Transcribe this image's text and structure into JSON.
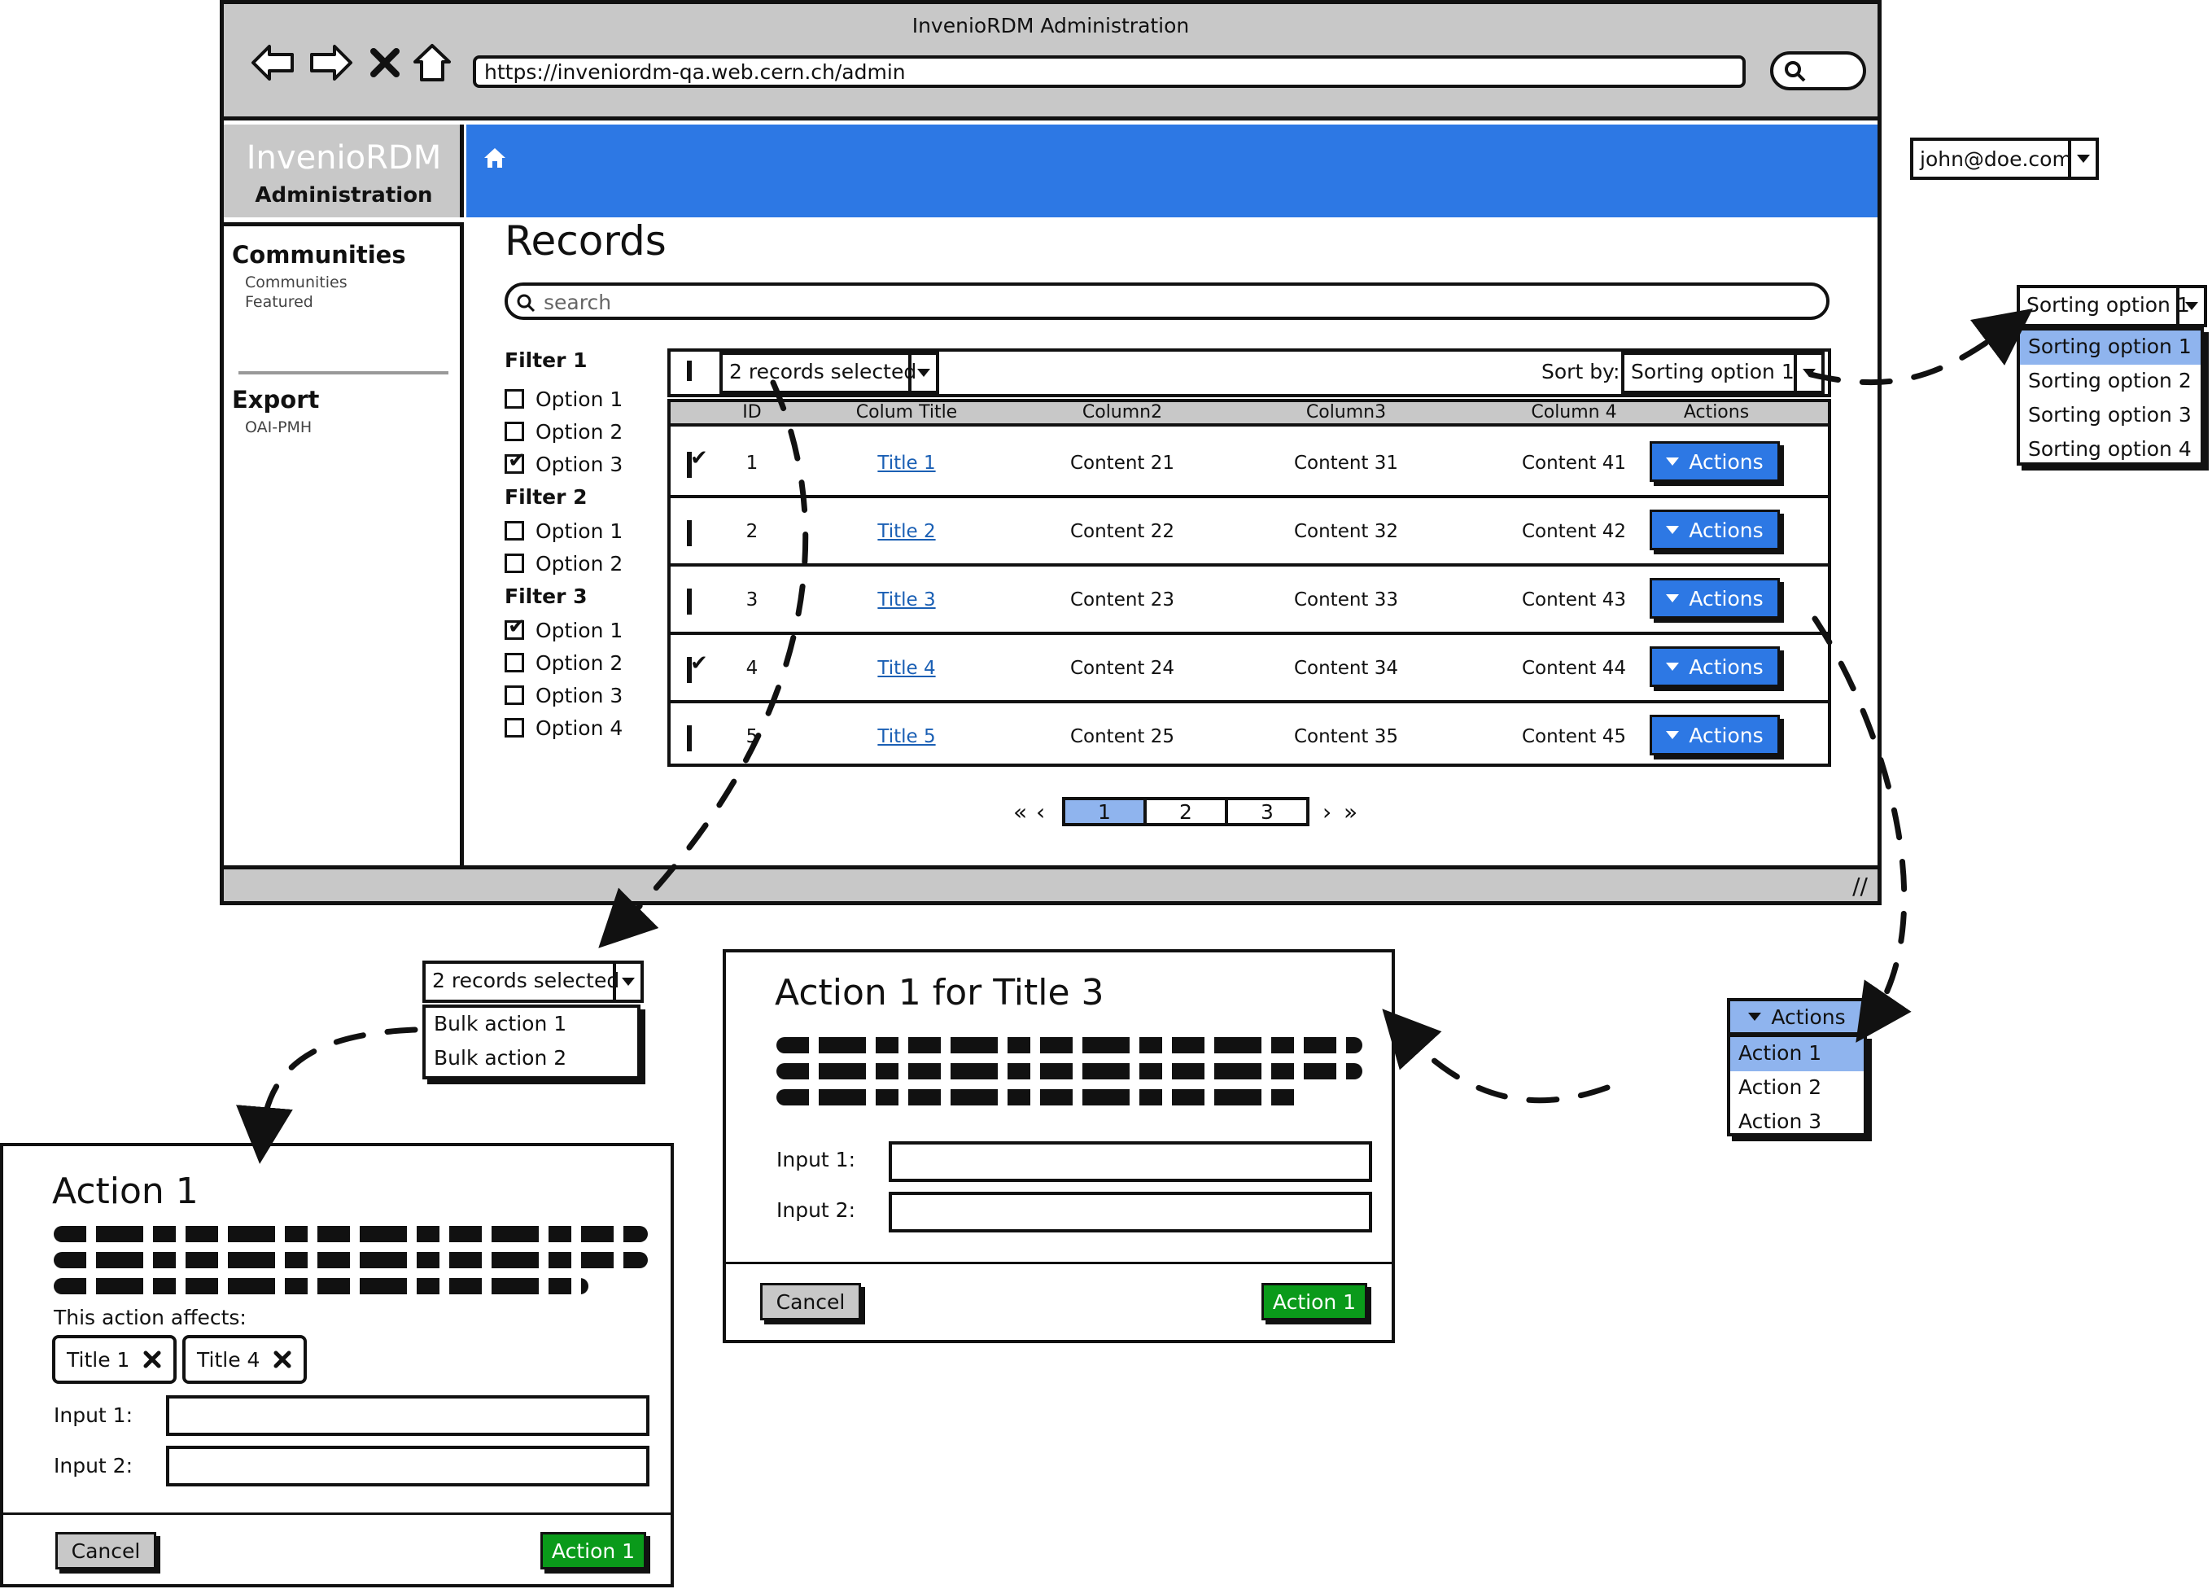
{
  "browser": {
    "window_title": "InvenioRDM Administration",
    "url": "https://inveniordm-qa.web.cern.ch/admin",
    "nav": {
      "back": "back-icon",
      "forward": "forward-icon",
      "stop": "close-icon",
      "home": "home-icon"
    }
  },
  "brand": {
    "title": "InvenioRDM",
    "subtitle": "Administration"
  },
  "topbar": {
    "user": "john@doe.com",
    "accent": "#2d78e4"
  },
  "sidebar": {
    "sections": [
      {
        "heading": "Communities",
        "items": [
          "Communities",
          "Featured"
        ]
      },
      {
        "heading": "Export",
        "items": [
          "OAI-PMH"
        ]
      }
    ]
  },
  "page": {
    "title": "Records",
    "search_placeholder": "search"
  },
  "filters": [
    {
      "heading": "Filter 1",
      "options": [
        {
          "label": "Option 1",
          "checked": false
        },
        {
          "label": "Option 2",
          "checked": false
        },
        {
          "label": "Option 3",
          "checked": true
        }
      ]
    },
    {
      "heading": "Filter 2",
      "options": [
        {
          "label": "Option 1",
          "checked": false
        },
        {
          "label": "Option 2",
          "checked": false
        }
      ]
    },
    {
      "heading": "Filter 3",
      "options": [
        {
          "label": "Option 1",
          "checked": true
        },
        {
          "label": "Option 2",
          "checked": false
        },
        {
          "label": "Option 3",
          "checked": false
        },
        {
          "label": "Option 4",
          "checked": false
        }
      ]
    }
  ],
  "toolbar": {
    "selection": "2 records selected",
    "sort_label": "Sort by:",
    "sort_value": "Sorting option 1"
  },
  "table": {
    "columns": [
      "ID",
      "Colum Title",
      "Column2",
      "Column3",
      "Column 4",
      "Actions"
    ],
    "rows": [
      {
        "checked": true,
        "id": "1",
        "title": "Title 1",
        "c2": "Content 21",
        "c3": "Content 31",
        "c4": "Content 41",
        "action": "Actions"
      },
      {
        "checked": false,
        "id": "2",
        "title": "Title 2",
        "c2": "Content 22",
        "c3": "Content 32",
        "c4": "Content 42",
        "action": "Actions"
      },
      {
        "checked": false,
        "id": "3",
        "title": "Title 3",
        "c2": "Content 23",
        "c3": "Content 33",
        "c4": "Content 43",
        "action": "Actions"
      },
      {
        "checked": true,
        "id": "4",
        "title": "Title 4",
        "c2": "Content 24",
        "c3": "Content 34",
        "c4": "Content 44",
        "action": "Actions"
      },
      {
        "checked": false,
        "id": "5",
        "title": "Title 5",
        "c2": "Content 25",
        "c3": "Content 35",
        "c4": "Content 45",
        "action": "Actions"
      }
    ]
  },
  "pagination": {
    "first": "«",
    "prev": "‹",
    "pages": [
      "1",
      "2",
      "3"
    ],
    "active": "1",
    "next": "›",
    "last": "»"
  },
  "sort_menu": {
    "value": "Sorting option 1",
    "options": [
      "Sorting option 1",
      "Sorting option 2",
      "Sorting option 3",
      "Sorting option 4"
    ],
    "selected": 0
  },
  "bulk_menu": {
    "value": "2 records selected",
    "options": [
      "Bulk action 1",
      "Bulk action 2"
    ]
  },
  "actions_menu": {
    "label": "Actions",
    "options": [
      "Action 1",
      "Action 2",
      "Action 3"
    ],
    "selected": 0
  },
  "dialog_bulk": {
    "title": "Action 1",
    "affects_label": "This action affects:",
    "chips": [
      "Title 1",
      "Title 4"
    ],
    "input1_label": "Input 1:",
    "input2_label": "Input 2:",
    "cancel": "Cancel",
    "confirm": "Action 1"
  },
  "dialog_single": {
    "title": "Action 1 for Title 3",
    "input1_label": "Input 1:",
    "input2_label": "Input 2:",
    "cancel": "Cancel",
    "confirm": "Action 1"
  },
  "colors": {
    "primary": "#2d78e4",
    "selected": "#8fb4ee",
    "success": "#0a9a1a",
    "chrome": "#c8c8c8"
  }
}
